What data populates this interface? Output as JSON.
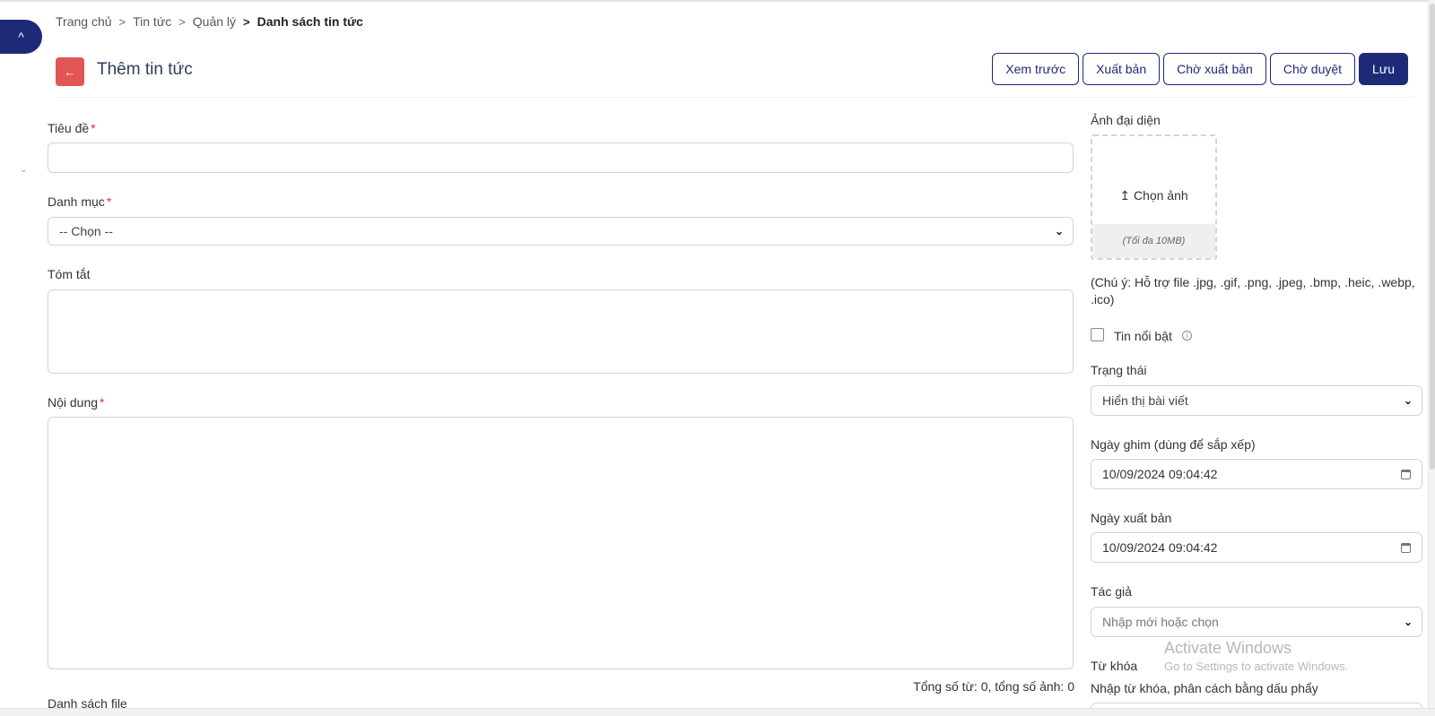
{
  "breadcrumb": {
    "items": [
      "Trang chủ",
      "Tin tức",
      "Quản lý"
    ],
    "current": "Danh sách tin tức",
    "separator": ">"
  },
  "header": {
    "title": "Thêm tin tức",
    "back_icon": "←",
    "collapse_icon": "^"
  },
  "toolbar": {
    "preview": "Xem trước",
    "publish": "Xuất bản",
    "pending_publish": "Chờ xuất bản",
    "pending_review": "Chờ duyệt",
    "save": "Lưu"
  },
  "form": {
    "title_label": "Tiêu đề",
    "category_label": "Danh mục",
    "category_value": "-- Chọn --",
    "summary_label": "Tóm tắt",
    "content_label": "Nội dung",
    "files_label": "Danh sách file",
    "required_mark": "*",
    "counter": "Tổng số từ: 0, tổng số ảnh: 0"
  },
  "sidebar_form": {
    "image_label": "Ảnh đại diện",
    "choose_image": "Chọn ảnh",
    "max_size": "(Tối đa 10MB)",
    "support_note": "(Chú ý: Hỗ trợ file .jpg, .gif, .png, .jpeg, .bmp, .heic, .webp, .ico)",
    "featured_label": "Tin nổi bật",
    "status_label": "Trạng thái",
    "status_value": "Hiển thị bài viết",
    "pin_date_label": "Ngày ghim (dùng để sắp xếp)",
    "pin_date_value": "10/09/2024 09:04:42",
    "publish_date_label": "Ngày xuất bản",
    "publish_date_value": "10/09/2024 09:04:42",
    "author_label": "Tác giả",
    "author_placeholder": "Nhập mới hoặc chọn",
    "keyword_label": "Từ khóa",
    "keyword_hint": "Nhập từ khóa, phân cách bằng dấu phẩy"
  },
  "watermark": {
    "line1": "Activate Windows",
    "line2": "Go to Settings to activate Windows."
  },
  "colors": {
    "primary": "#1e2a78",
    "back_button": "#e25555",
    "required": "#e03131"
  }
}
